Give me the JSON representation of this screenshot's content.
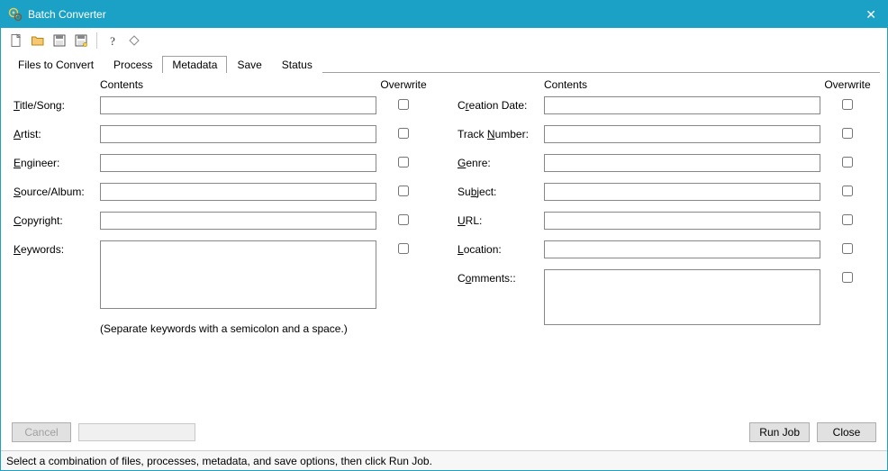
{
  "window": {
    "title": "Batch Converter"
  },
  "tabs": {
    "files": "Files to Convert",
    "process": "Process",
    "metadata": "Metadata",
    "save": "Save",
    "status": "Status"
  },
  "headers": {
    "contents": "Contents",
    "overwrite": "Overwrite"
  },
  "left_fields": {
    "title": {
      "pre": "",
      "u": "T",
      "post": "itle/Song:",
      "value": ""
    },
    "artist": {
      "pre": "",
      "u": "A",
      "post": "rtist:",
      "value": ""
    },
    "engineer": {
      "pre": "",
      "u": "E",
      "post": "ngineer:",
      "value": ""
    },
    "source": {
      "pre": "",
      "u": "S",
      "post": "ource/Album:",
      "value": ""
    },
    "copyright": {
      "pre": "",
      "u": "C",
      "post": "opyright:",
      "value": ""
    },
    "keywords": {
      "pre": "",
      "u": "K",
      "post": "eywords:",
      "value": ""
    }
  },
  "keywords_hint": "(Separate keywords with a semicolon and a space.)",
  "right_fields": {
    "creation": {
      "pre": "C",
      "u": "r",
      "post": "eation Date:",
      "value": ""
    },
    "track": {
      "pre": "Track ",
      "u": "N",
      "post": "umber:",
      "value": ""
    },
    "genre": {
      "pre": "",
      "u": "G",
      "post": "enre:",
      "value": ""
    },
    "subject": {
      "pre": "Su",
      "u": "b",
      "post": "ject:",
      "value": ""
    },
    "url": {
      "pre": "",
      "u": "U",
      "post": "RL:",
      "value": ""
    },
    "location": {
      "pre": "",
      "u": "L",
      "post": "ocation:",
      "value": ""
    },
    "comments": {
      "pre": "C",
      "u": "o",
      "post": "mments::",
      "value": ""
    }
  },
  "buttons": {
    "cancel": "Cancel",
    "run": "Run Job",
    "close": "Close"
  },
  "status_text": "Select a combination of files, processes, metadata, and save options, then click Run Job."
}
